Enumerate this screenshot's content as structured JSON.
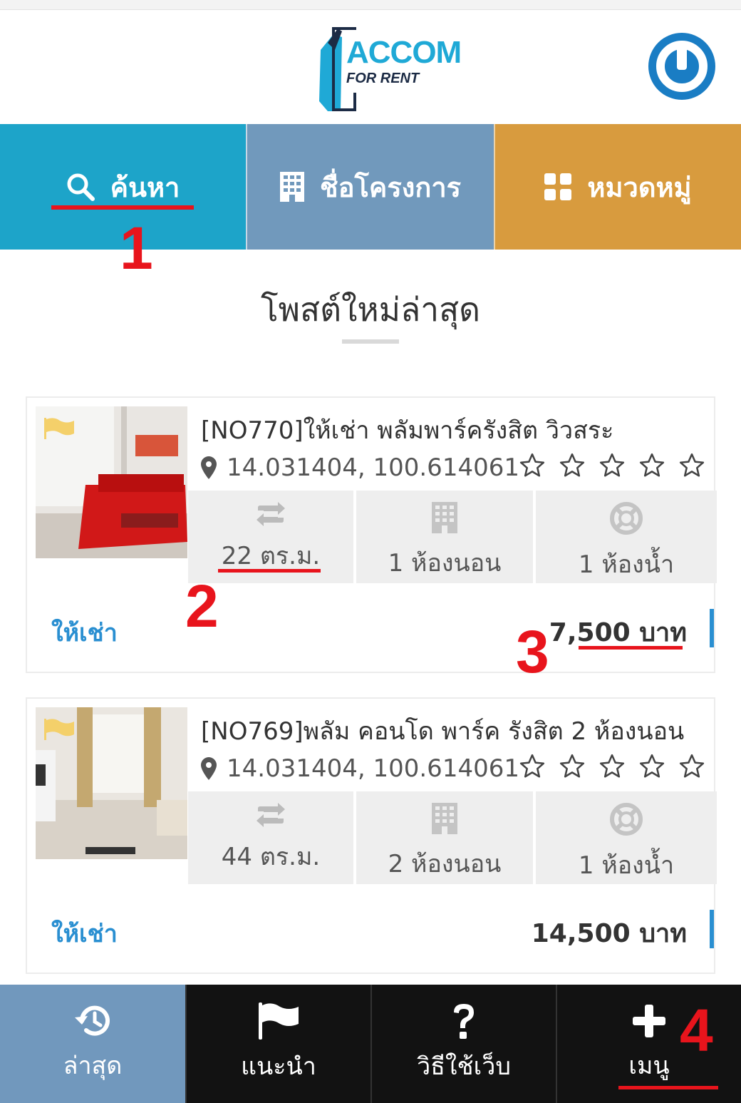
{
  "header": {
    "logo_title": "ACCOM",
    "logo_subtitle": "FOR RENT",
    "colors": {
      "brand_blue": "#1fa9d6",
      "power_blue": "#1a7dc4"
    }
  },
  "tabs": [
    {
      "label": "ค้นหา",
      "icon": "search-icon",
      "color": "#1da4c9"
    },
    {
      "label": "ชื่อโครงการ",
      "icon": "building-icon",
      "color": "#7199bc"
    },
    {
      "label": "หมวดหมู่",
      "icon": "grid-icon",
      "color": "#d89b3e"
    }
  ],
  "section": {
    "title": "โพสต์ใหม่ล่าสุด"
  },
  "listings": [
    {
      "title": "[NO770]ให้เช่า พลัมพาร์ครังสิต วิวสระ",
      "coords": "14.031404, 100.614061",
      "area": "22 ตร.ม.",
      "bedrooms": "1 ห้องนอน",
      "bathrooms": "1 ห้องน้ำ",
      "type": "ให้เช่า",
      "price": "7,500 บาท",
      "rating": 0
    },
    {
      "title": "[NO769]พลัม คอนโด พาร์ค รังสิต 2 ห้องนอน",
      "coords": "14.031404, 100.614061",
      "area": "44 ตร.ม.",
      "bedrooms": "2 ห้องนอน",
      "bathrooms": "1 ห้องน้ำ",
      "type": "ให้เช่า",
      "price": "14,500 บาท",
      "rating": 0
    }
  ],
  "bottom_nav": [
    {
      "label": "ล่าสุด",
      "icon": "history-icon"
    },
    {
      "label": "แนะนำ",
      "icon": "flag-icon"
    },
    {
      "label": "วิธีใช้เว็บ",
      "icon": "question-icon"
    },
    {
      "label": "เมนู",
      "icon": "plus-icon"
    }
  ],
  "annotations": [
    "1",
    "2",
    "3",
    "4"
  ],
  "colors": {
    "annotation_red": "#e8141c",
    "accent_blue": "#2a8fd1"
  }
}
